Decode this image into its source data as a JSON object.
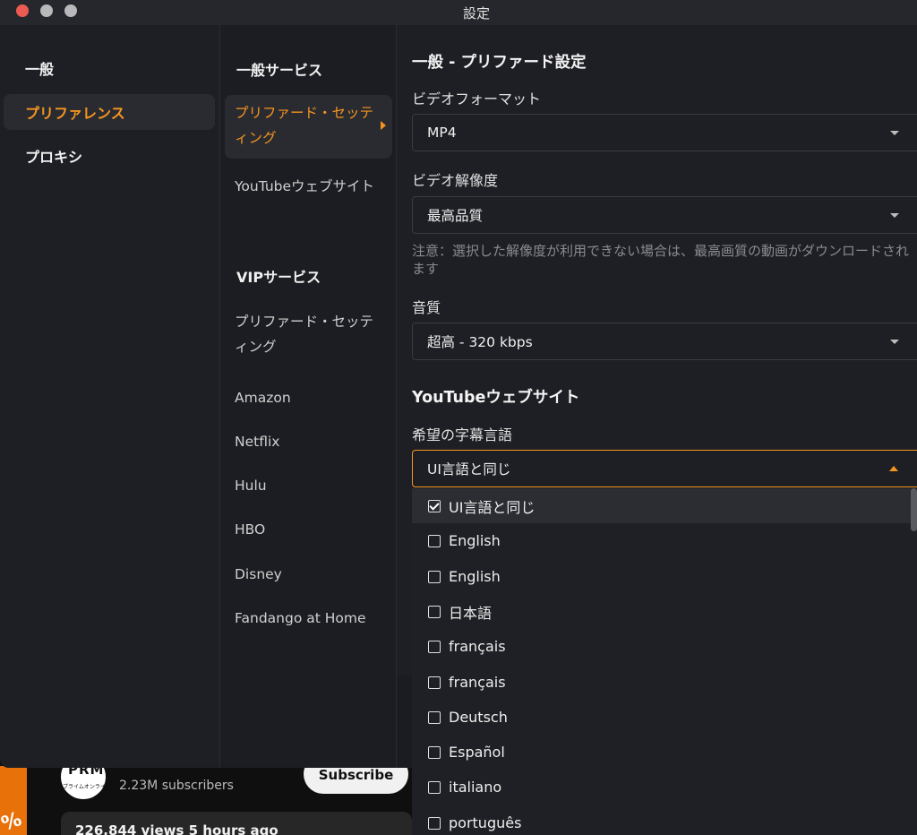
{
  "window": {
    "title": "設定"
  },
  "background": {
    "subscribers": "2.23M subscribers",
    "subscribe_label": "Subscribe",
    "views": "226,844 views  5 hours ago",
    "channel_logo_text": "PRM",
    "channel_logo_sub": "プライムオンライン",
    "badge": "%"
  },
  "nav_primary": [
    {
      "label": "一般"
    },
    {
      "label": "プリファレンス",
      "active": true
    },
    {
      "label": "プロキシ"
    }
  ],
  "nav_secondary": {
    "general_heading": "一般サービス",
    "general_items": [
      {
        "label": "プリファード・セッティング",
        "active": true
      },
      {
        "label": "YouTubeウェブサイト"
      }
    ],
    "vip_heading": "VIPサービス",
    "vip_items": [
      {
        "label": "プリファード・セッティング"
      },
      {
        "label": "Amazon"
      },
      {
        "label": "Netflix"
      },
      {
        "label": "Hulu"
      },
      {
        "label": "HBO"
      },
      {
        "label": "Disney"
      },
      {
        "label": "Fandango at Home"
      }
    ]
  },
  "main": {
    "heading": "一般 - プリファード設定",
    "video_format": {
      "label": "ビデオフォーマット",
      "value": "MP4"
    },
    "video_resolution": {
      "label": "ビデオ解像度",
      "value": "最高品質",
      "note": "注意：選択した解像度が利用できない場合は、最高画質の動画がダウンロードされます"
    },
    "audio_quality": {
      "label": "音質",
      "value": "超高 - 320 kbps"
    },
    "youtube_heading": "YouTubeウェブサイト",
    "subtitle_language": {
      "label": "希望の字幕言語",
      "value": "UI言語と同じ",
      "options": [
        {
          "label": "UI言語と同じ",
          "checked": true
        },
        {
          "label": "English",
          "checked": false
        },
        {
          "label": "English",
          "checked": false
        },
        {
          "label": "日本語",
          "checked": false
        },
        {
          "label": "français",
          "checked": false
        },
        {
          "label": "français",
          "checked": false
        },
        {
          "label": "Deutsch",
          "checked": false
        },
        {
          "label": "Español",
          "checked": false
        },
        {
          "label": "italiano",
          "checked": false
        },
        {
          "label": "português",
          "checked": false
        }
      ]
    }
  },
  "colors": {
    "accent": "#f5951f",
    "panel": "#1e1f24",
    "text": "#f1f1f1"
  }
}
